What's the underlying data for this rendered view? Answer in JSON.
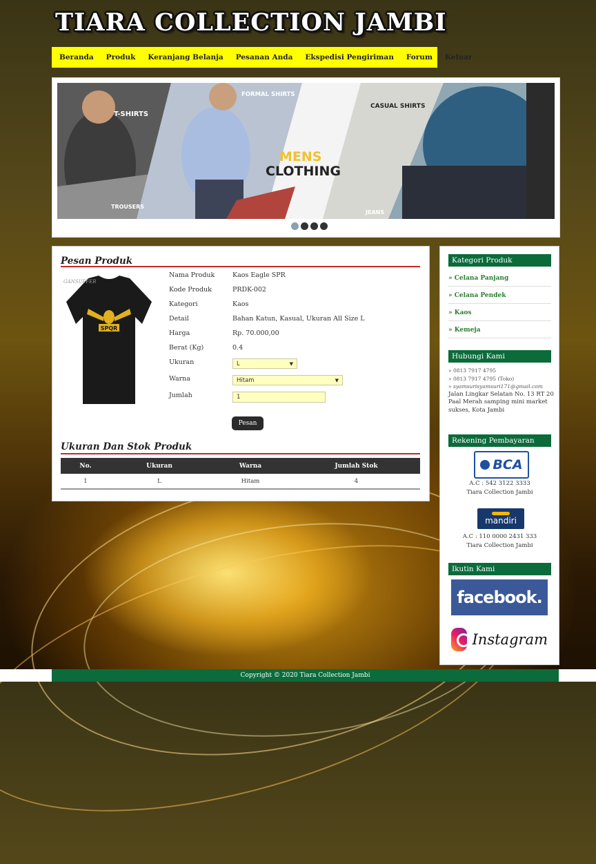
{
  "site": {
    "title": "TIARA COLLECTION JAMBI"
  },
  "nav": [
    "Beranda",
    "Produk",
    "Keranjang Belanja",
    "Pesanan Anda",
    "Ekspedisi Pengiriman",
    "Forum",
    "Keluar"
  ],
  "banner": {
    "labels": {
      "tshirts": "T-SHIRTS",
      "formal": "FORMAL SHIRTS",
      "casual": "CASUAL SHIRTS",
      "mens": "MENS",
      "clothing": "CLOTHING",
      "trousers": "TROUSERS",
      "jeans": "JEANS"
    },
    "slide_count": 4,
    "active_slide": 1
  },
  "order": {
    "title": "Pesan Produk",
    "product_image_watermark": "GANSUFFER",
    "product_image_print": "SPQR",
    "fields": {
      "name_label": "Nama Produk",
      "name": "Kaos Eagle SPR",
      "code_label": "Kode Produk",
      "code": "PRDK-002",
      "category_label": "Kategori",
      "category": "Kaos",
      "detail_label": "Detail",
      "detail": "Bahan Katun, Kasual, Ukuran All Size L",
      "price_label": "Harga",
      "price": "Rp. 70.000,00",
      "weight_label": "Berat (Kg)",
      "weight": "0.4",
      "size_label": "Ukuran",
      "size_value": "L",
      "color_label": "Warna",
      "color_value": "Hitam",
      "qty_label": "Jumlah",
      "qty_value": "1"
    },
    "submit_label": "Pesan"
  },
  "stock": {
    "title": "Ukuran Dan Stok Produk",
    "headers": [
      "No.",
      "Ukuran",
      "Warna",
      "Jumlah Stok"
    ],
    "rows": [
      [
        "1",
        "L",
        "Hitam",
        "4"
      ]
    ]
  },
  "sidebar": {
    "category_title": "Kategori Produk",
    "categories": [
      "» Celana Panjang",
      "» Celana Pendek",
      "» Kaos",
      "» Kemeja"
    ],
    "contact_title": "Hubungi Kami",
    "phone1": "» 0813 7917 4795",
    "phone2": "» 0813 7917 4795 (Toko)",
    "email": "» syamsurisyamsuri171@gmail.com",
    "address": "Jalan Lingkar Selatan No. 13 RT 20 Paal Merah samping mini market sukses, Kota Jambi",
    "payment_title": "Rekening Pembayaran",
    "bca_logo": "BCA",
    "bca_account": "A.C : 542 3122 3333",
    "bca_name": "Tiara Collection Jambi",
    "mandiri_logo": "mandiri",
    "mandiri_account": "A.C : 110 0000 2431 333",
    "mandiri_name": "Tiara Collection Jambi",
    "follow_title": "Ikutin Kami",
    "facebook": "facebook.",
    "instagram": "Instagram"
  },
  "footer": {
    "copyright": "Copyright © 2020 Tiara Collection Jambi"
  },
  "colors": {
    "nav_bg": "#ffff00",
    "accent_green": "#0b6b3b",
    "title_red": "#c62828",
    "input_bg": "#ffffc0"
  }
}
